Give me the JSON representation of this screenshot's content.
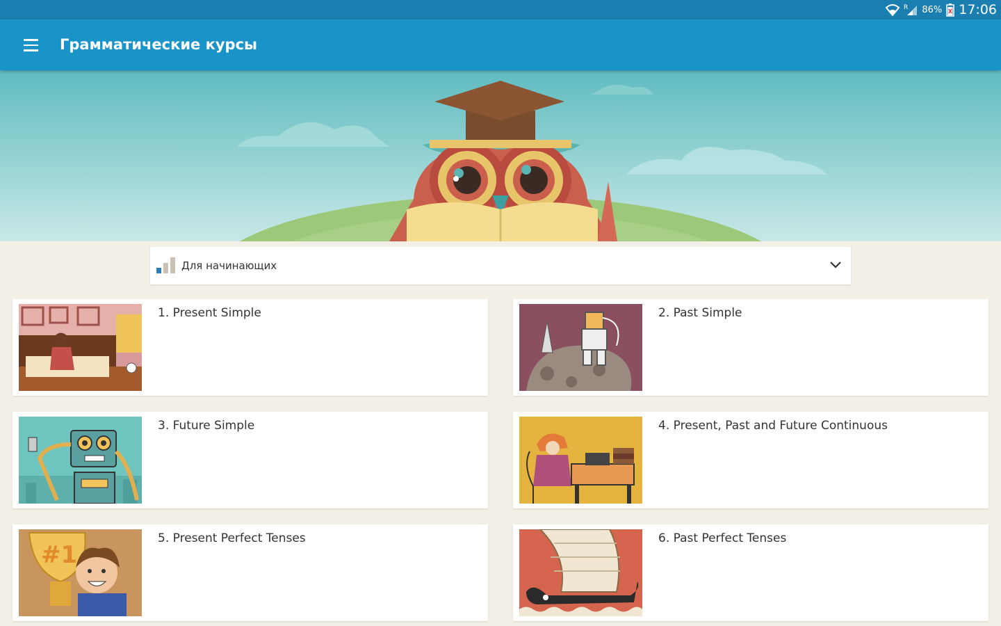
{
  "status_bar": {
    "battery": "86%",
    "time": "17:06",
    "roaming": "R"
  },
  "app_bar": {
    "title": "Грамматические курсы",
    "menu_icon": "hamburger-menu-icon"
  },
  "hero": {
    "image": "owl-graduate-illustration"
  },
  "level_select": {
    "selected": "Для начинающих",
    "icon": "level-bars-icon"
  },
  "courses": [
    {
      "title": "1. Present Simple",
      "image": "girl-waking-up-illustration"
    },
    {
      "title": "2. Past Simple",
      "image": "astronaut-on-moon-illustration"
    },
    {
      "title": "3. Future Simple",
      "image": "robot-illustration"
    },
    {
      "title": "4. Present, Past and Future Continuous",
      "image": "woman-typewriter-illustration"
    },
    {
      "title": "5. Present Perfect Tenses",
      "image": "boy-with-trophy-illustration"
    },
    {
      "title": "6. Past Perfect Tenses",
      "image": "ancient-ship-illustration"
    }
  ],
  "colors": {
    "status_bar": "#1a7fb0",
    "app_bar": "#1a93c9",
    "background": "#f4efe6",
    "sky_top": "#5fbcc0",
    "sky_bottom": "#bfe4e4",
    "hill": "#9cc87a"
  }
}
